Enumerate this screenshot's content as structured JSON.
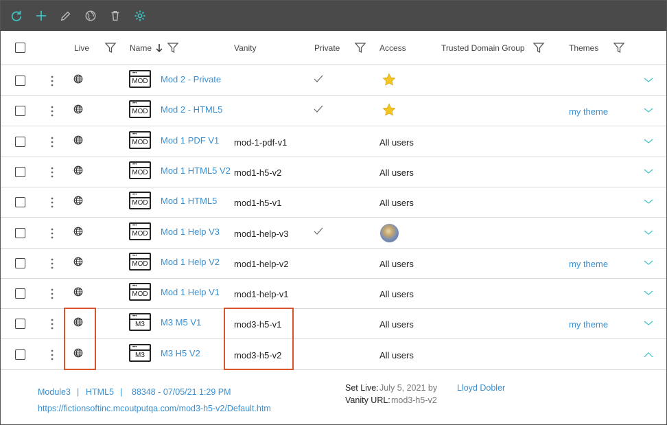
{
  "toolbar": {
    "buttons": [
      {
        "icon": "refresh-icon"
      },
      {
        "icon": "plus-icon"
      },
      {
        "icon": "pencil-icon"
      },
      {
        "icon": "globe-publish-icon"
      },
      {
        "icon": "trash-icon"
      },
      {
        "icon": "gear-icon"
      }
    ],
    "bg_color": "#4a4a4a",
    "accent_color": "#3ec1c1"
  },
  "table": {
    "columns": {
      "live": "Live",
      "name": "Name",
      "vanity": "Vanity",
      "private": "Private",
      "access": "Access",
      "trusted": "Trusted Domain Group",
      "themes": "Themes"
    },
    "sort": {
      "column": "Name",
      "direction": "descending"
    },
    "rows": [
      {
        "icon_label": "MOD",
        "name": "Mod 2 - Private",
        "vanity": "",
        "private": true,
        "access": "",
        "access_icon": "star-icon",
        "theme": "",
        "expanded": false
      },
      {
        "icon_label": "MOD",
        "name": "Mod 2 - HTML5",
        "vanity": "",
        "private": true,
        "access": "",
        "access_icon": "star-icon",
        "theme": "my theme",
        "expanded": false
      },
      {
        "icon_label": "MOD",
        "name": "Mod 1 PDF V1",
        "vanity": "mod-1-pdf-v1",
        "private": false,
        "access": "All users",
        "access_icon": "",
        "theme": "",
        "expanded": false
      },
      {
        "icon_label": "MOD",
        "name": "Mod 1 HTML5 V2",
        "vanity": "mod1-h5-v2",
        "private": false,
        "access": "All users",
        "access_icon": "",
        "theme": "",
        "expanded": false
      },
      {
        "icon_label": "MOD",
        "name": "Mod 1 HTML5",
        "vanity": "mod1-h5-v1",
        "private": false,
        "access": "All users",
        "access_icon": "",
        "theme": "",
        "expanded": false
      },
      {
        "icon_label": "MOD",
        "name": "Mod 1 Help V3",
        "vanity": "mod1-help-v3",
        "private": true,
        "access": "",
        "access_icon": "avatar",
        "theme": "",
        "expanded": false
      },
      {
        "icon_label": "MOD",
        "name": "Mod 1 Help V2",
        "vanity": "mod1-help-v2",
        "private": false,
        "access": "All users",
        "access_icon": "",
        "theme": "my theme",
        "expanded": false
      },
      {
        "icon_label": "MOD",
        "name": "Mod 1 Help V1",
        "vanity": "mod1-help-v1",
        "private": false,
        "access": "All users",
        "access_icon": "",
        "theme": "",
        "expanded": false
      },
      {
        "icon_label": "M3",
        "name": "M3 M5 V1",
        "vanity": "mod3-h5-v1",
        "private": false,
        "access": "All users",
        "access_icon": "",
        "theme": "my theme",
        "expanded": false
      },
      {
        "icon_label": "M3",
        "name": "M3 H5 V2",
        "vanity": "mod3-h5-v2",
        "private": false,
        "access": "All users",
        "access_icon": "",
        "theme": "",
        "expanded": true
      }
    ]
  },
  "detail": {
    "module": "Module3",
    "sep1": "|",
    "format": "HTML5",
    "sep2": "|",
    "build": "88348 - 07/05/21 1:29 PM",
    "url": "https://fictionsoftinc.mcoutputqa.com/mod3-h5-v2/Default.htm",
    "set_live_label": "Set Live:",
    "set_live_date": "July 5, 2021 by",
    "set_live_user": "Lloyd Dobler",
    "vanity_label": "Vanity URL:",
    "vanity_value": "mod3-h5-v2"
  },
  "colors": {
    "link": "#3a8fd0",
    "highlight": "#d9542b",
    "chevron": "#3ec1c1"
  }
}
